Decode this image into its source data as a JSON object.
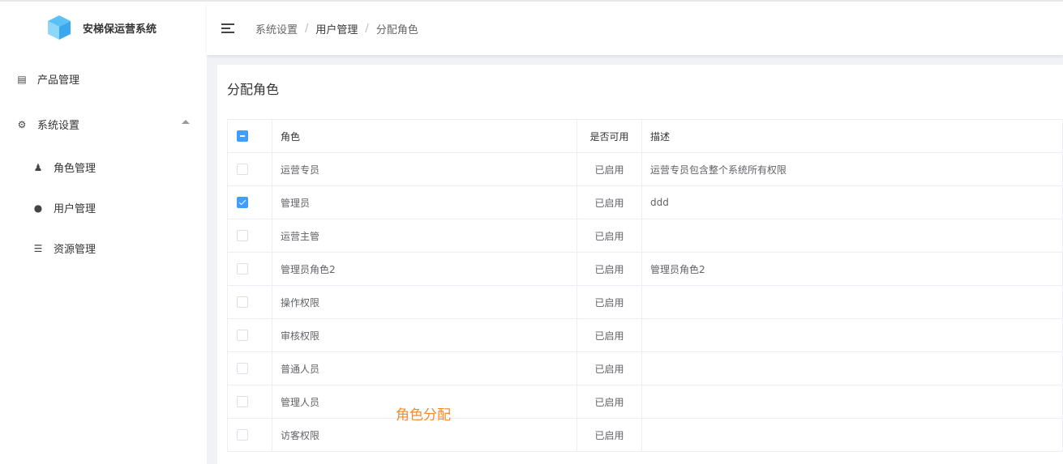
{
  "app": {
    "title": "安梯保运营系统"
  },
  "sidebar": {
    "items": [
      {
        "label": "产品管理",
        "icon": "clipboard-icon"
      },
      {
        "label": "系统设置",
        "icon": "gears-icon",
        "expanded": true
      },
      {
        "label": "角色管理",
        "icon": "user-secret-icon"
      },
      {
        "label": "用户管理",
        "icon": "user-icon"
      },
      {
        "label": "资源管理",
        "icon": "list-icon"
      }
    ]
  },
  "breadcrumb": [
    "系统设置",
    "用户管理",
    "分配角色"
  ],
  "card": {
    "title": "分配角色"
  },
  "table": {
    "headers": [
      "角色",
      "是否可用",
      "描述"
    ],
    "select_all_state": "indeterminate",
    "rows": [
      {
        "role": "运营专员",
        "status": "已启用",
        "desc": "运营专员包含整个系统所有权限",
        "checked": false
      },
      {
        "role": "管理员",
        "status": "已启用",
        "desc": "ddd",
        "checked": true
      },
      {
        "role": "运营主管",
        "status": "已启用",
        "desc": "",
        "checked": false
      },
      {
        "role": "管理员角色2",
        "status": "已启用",
        "desc": "管理员角色2",
        "checked": false
      },
      {
        "role": "操作权限",
        "status": "已启用",
        "desc": "",
        "checked": false
      },
      {
        "role": "审核权限",
        "status": "已启用",
        "desc": "",
        "checked": false
      },
      {
        "role": "普通人员",
        "status": "已启用",
        "desc": "",
        "checked": false
      },
      {
        "role": "管理人员",
        "status": "已启用",
        "desc": "",
        "checked": false
      },
      {
        "role": "访客权限",
        "status": "已启用",
        "desc": "",
        "checked": false
      }
    ]
  },
  "watermark": "角色分配",
  "colors": {
    "primary": "#409eff",
    "watermark": "#f08c2e"
  }
}
